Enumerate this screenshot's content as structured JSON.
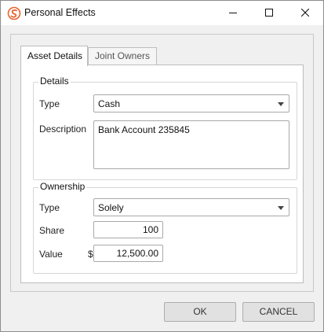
{
  "window": {
    "title": "Personal Effects",
    "app_icon": "app-logo-icon",
    "controls": {
      "minimize_icon": "minimize-icon",
      "maximize_icon": "maximize-icon",
      "close_icon": "close-icon"
    }
  },
  "tabs": [
    {
      "label": "Asset Details",
      "active": true
    },
    {
      "label": "Joint Owners",
      "active": false
    }
  ],
  "details": {
    "group_title": "Details",
    "type_label": "Type",
    "type_value": "Cash",
    "description_label": "Description",
    "description_value": "Bank Account 235845"
  },
  "ownership": {
    "group_title": "Ownership",
    "type_label": "Type",
    "type_value": "Solely",
    "share_label": "Share",
    "share_value": "100",
    "value_label": "Value",
    "currency_symbol": "$",
    "value_value": "12,500.00"
  },
  "buttons": {
    "ok_label": "OK",
    "cancel_label": "CANCEL"
  },
  "colors": {
    "accent": "#e8612c",
    "window_bg": "#f0f0f0",
    "button_bg": "#e1e1e1"
  }
}
